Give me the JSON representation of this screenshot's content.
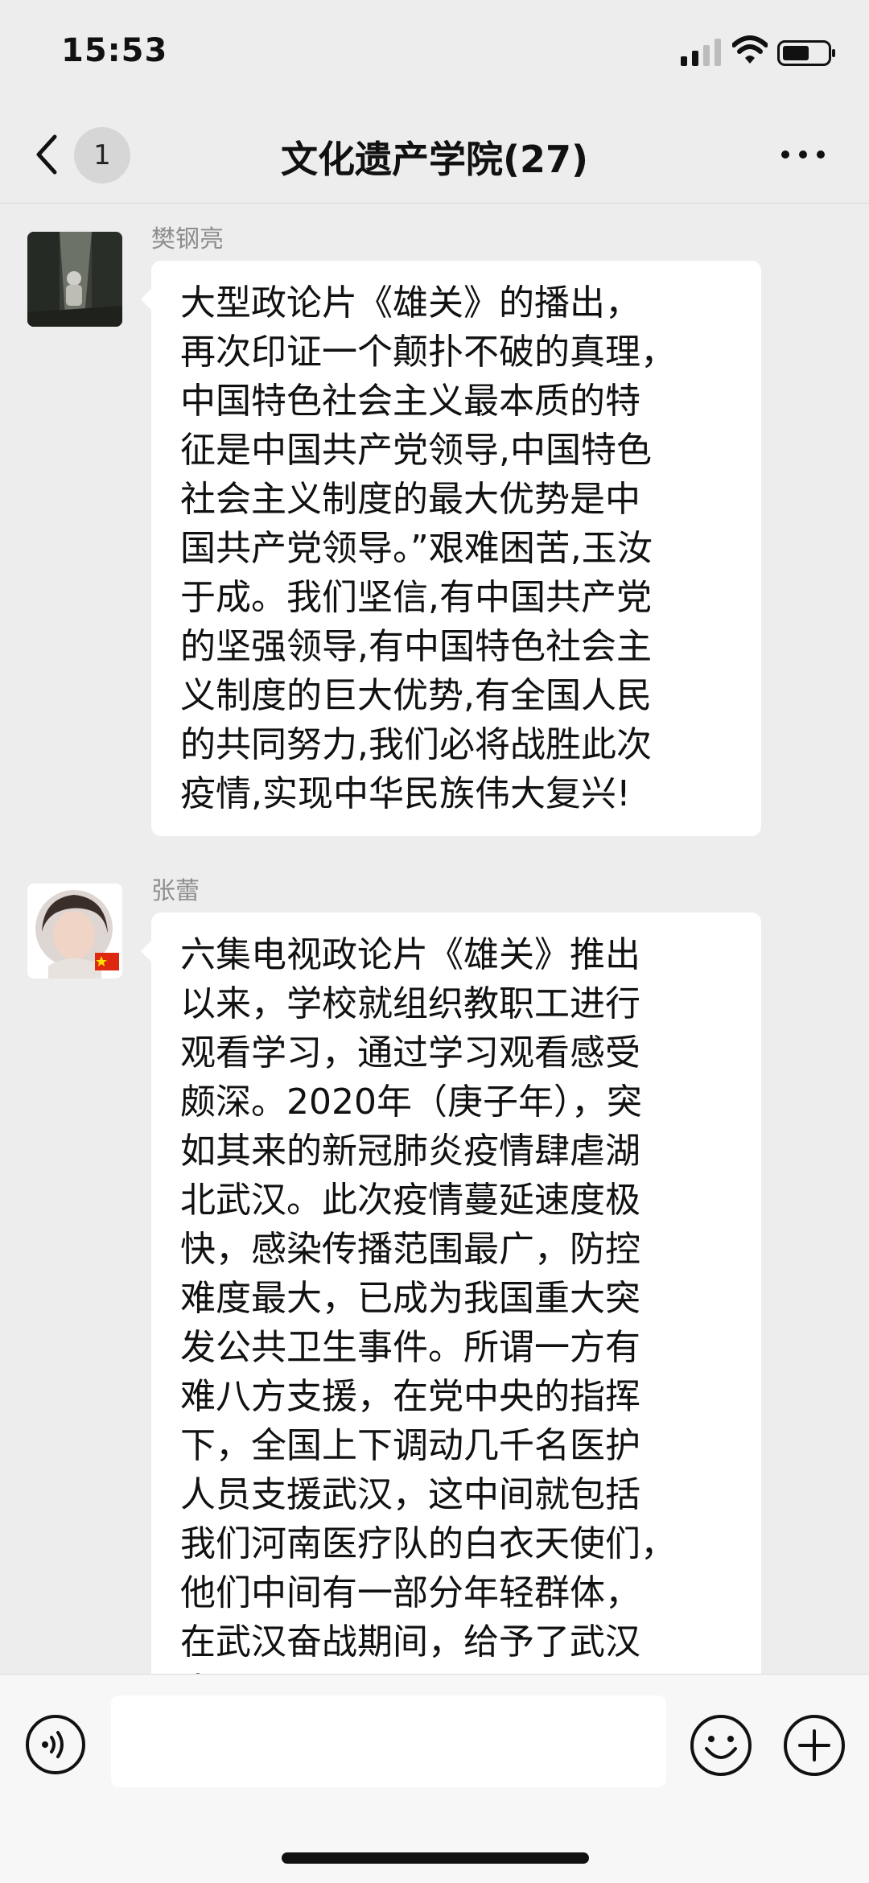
{
  "status_bar": {
    "time": "15:53"
  },
  "nav": {
    "unread_count": "1",
    "title": "文化遗产学院(27)"
  },
  "messages": [
    {
      "sender": "樊钢亮",
      "text": "大型政论片《雄关》的播出，\n再次印证一个颠扑不破的真理，\n中国特色社会主义最本质的特\n征是中国共产党领导,中国特色\n社会主义制度的最大优势是中\n国共产党领导。”艰难困苦,玉汝\n于成。我们坚信,有中国共产党\n的坚强领导,有中国特色社会主\n义制度的巨大优势,有全国人民\n的共同努力,我们必将战胜此次\n疫情,实现中华民族伟大复兴!"
    },
    {
      "sender": "张蕾",
      "text": "六集电视政论片《雄关》推出\n以来，学校就组织教职工进行\n观看学习，通过学习观看感受\n颇深。2020年（庚子年），突\n如其来的新冠肺炎疫情肆虐湖\n北武汉。此次疫情蔓延速度极\n快，感染传播范围最广，防控\n难度最大，已成为我国重大突\n发公共卫生事件。所谓一方有\n难八方支援，在党中央的指挥\n下，全国上下调动几千名医护\n人员支援武汉，这中间就包括\n我们河南医疗队的白衣天使们，\n他们中间有一部分年轻群体，\n在武汉奋战期间，给予了武汉\n人民…"
    }
  ],
  "icons": {
    "back": "back-arrow-icon",
    "more": "more-dots-icon",
    "voice": "voice-input-icon",
    "emoji": "emoji-icon",
    "plus": "plus-icon"
  }
}
